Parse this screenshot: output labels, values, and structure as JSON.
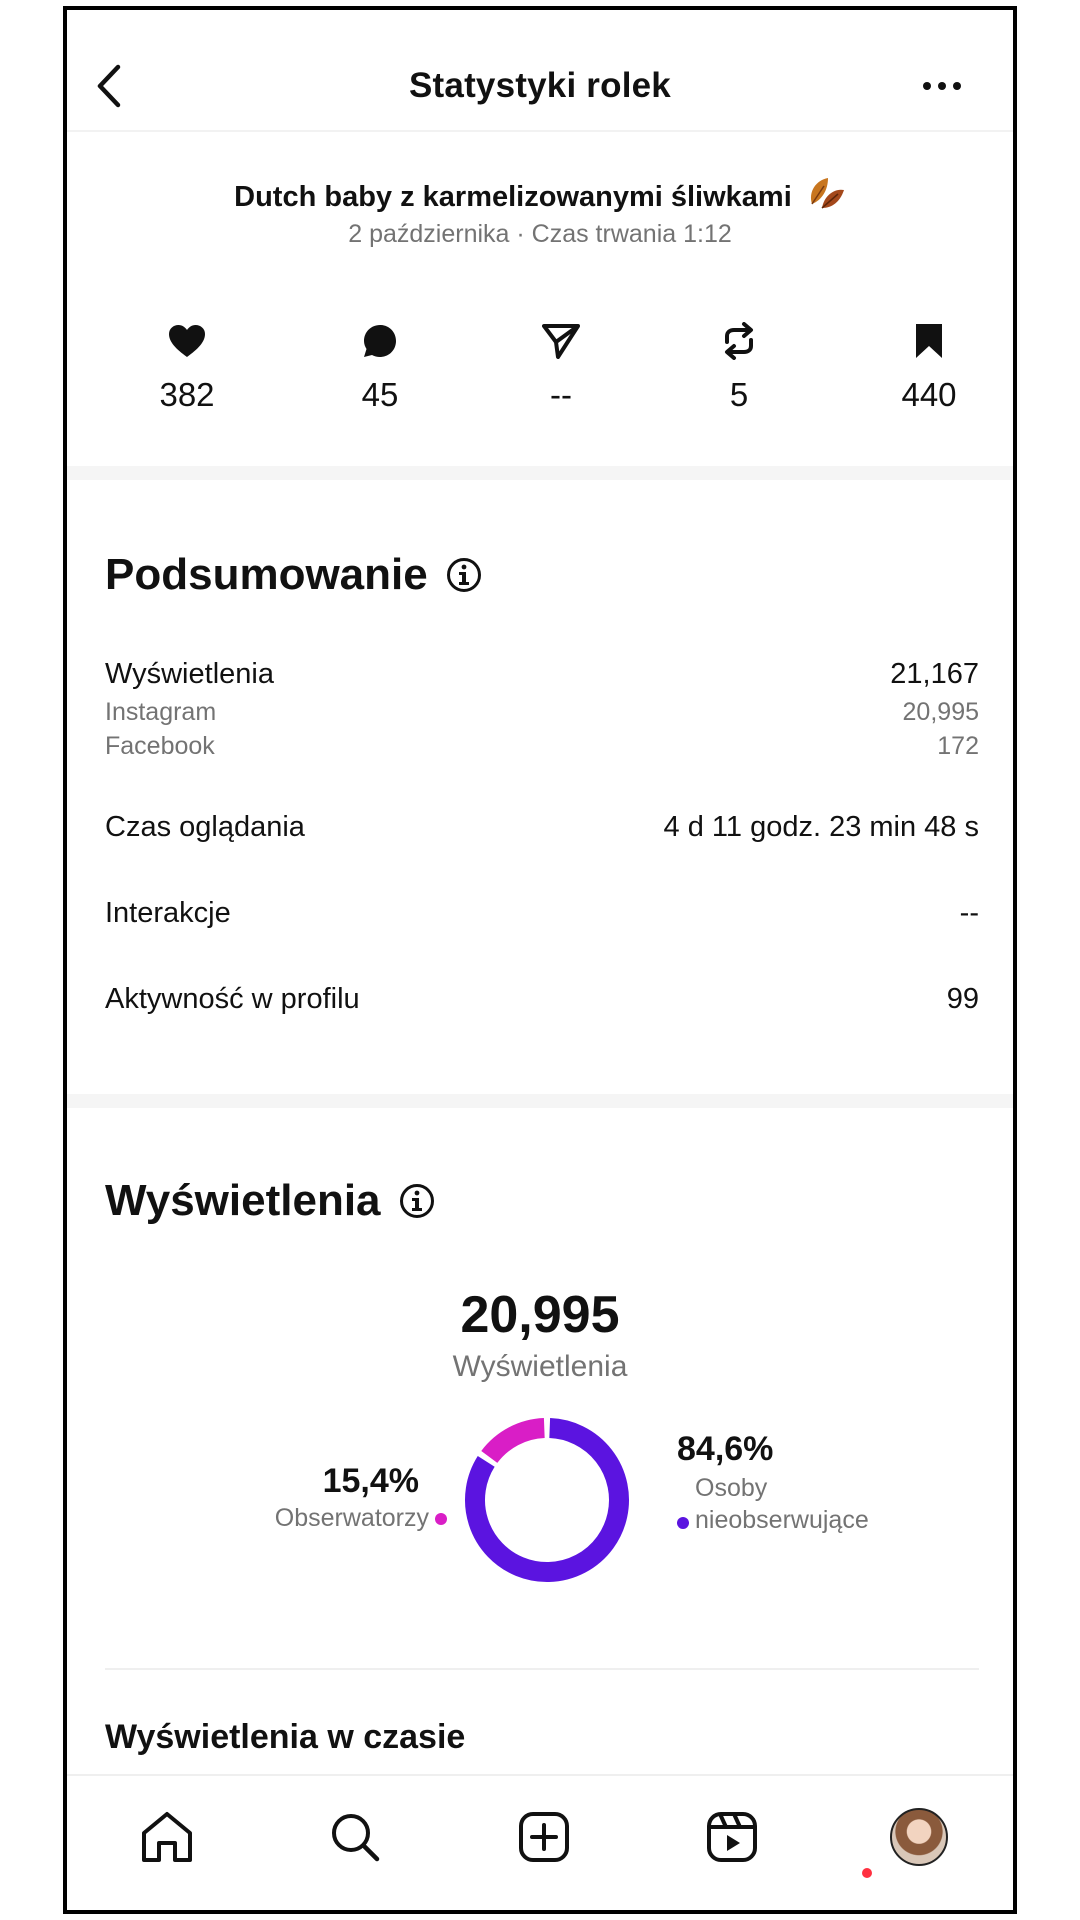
{
  "header": {
    "title": "Statystyki rolek"
  },
  "reel": {
    "title": "Dutch baby z karmelizowanymi śliwkami",
    "meta": "2 października · Czas trwania 1:12"
  },
  "stats": {
    "likes": "382",
    "comments": "45",
    "shares": "--",
    "reposts": "5",
    "saves": "440"
  },
  "summary": {
    "title": "Podsumowanie",
    "views_label": "Wyświetlenia",
    "views_value": "21,167",
    "instagram_label": "Instagram",
    "instagram_value": "20,995",
    "facebook_label": "Facebook",
    "facebook_value": "172",
    "watch_time_label": "Czas oglądania",
    "watch_time_value": "4 d 11 godz. 23 min 48 s",
    "interactions_label": "Interakcje",
    "interactions_value": "--",
    "profile_activity_label": "Aktywność w profilu",
    "profile_activity_value": "99"
  },
  "views": {
    "title": "Wyświetlenia",
    "total": "20,995",
    "total_label": "Wyświetlenia",
    "followers_pct_label": "15,4%",
    "followers_label": "Obserwatorzy",
    "non_followers_pct_label": "84,6%",
    "non_followers_label": "Osoby nieobserwujące",
    "followers_pct": 15.4,
    "non_followers_pct": 84.6,
    "colors": {
      "followers": "#d91ec6",
      "non_followers": "#5b14e0"
    },
    "over_time_title": "Wyświetlenia w czasie"
  },
  "nav": {
    "items": [
      "home-icon",
      "search-icon",
      "create-icon",
      "reels-icon",
      "profile-avatar"
    ]
  }
}
